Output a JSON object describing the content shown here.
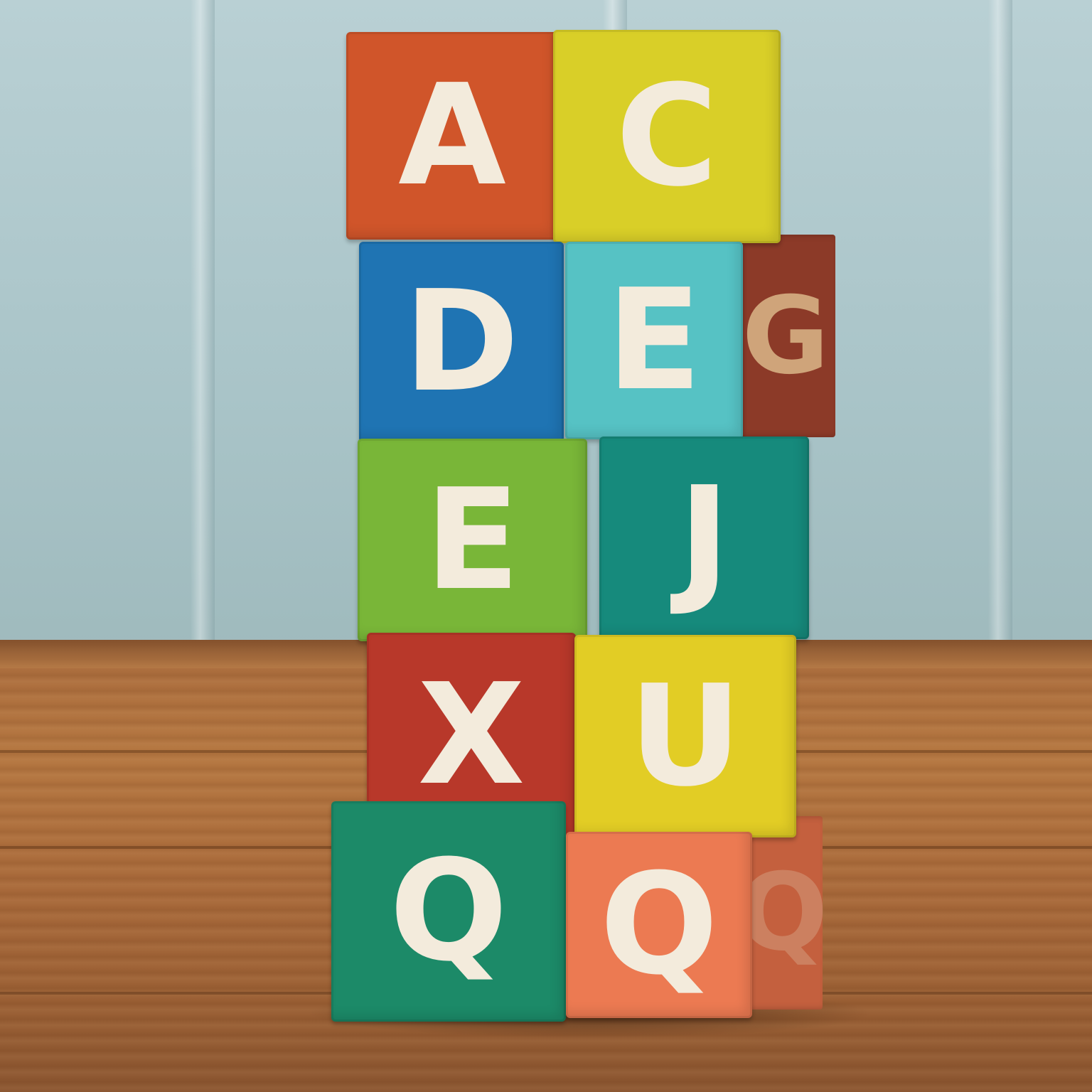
{
  "blocks": [
    {
      "letter": "A",
      "color": "#d0552a"
    },
    {
      "letter": "C",
      "color": "#d9cf28"
    },
    {
      "letter": "D",
      "color": "#1f74b3"
    },
    {
      "letter": "E",
      "color": "#56c2c4"
    },
    {
      "letter": "E",
      "color": "#79b638"
    },
    {
      "letter": "J",
      "color": "#168a7c"
    },
    {
      "letter": "X",
      "color": "#b8382a"
    },
    {
      "letter": "U",
      "color": "#e2cd25"
    },
    {
      "letter": "Q",
      "color": "#1c8a68"
    },
    {
      "letter": "Q",
      "color": "#ec7a52"
    }
  ],
  "side_faces": [
    {
      "letter": "G",
      "color": "#8c3a28"
    },
    {
      "letter": "Q",
      "color": "#c4603e"
    }
  ],
  "colors": {
    "wall": "#aac5c9",
    "table": "#ad6e3e",
    "letter": "#f3ebdc"
  }
}
